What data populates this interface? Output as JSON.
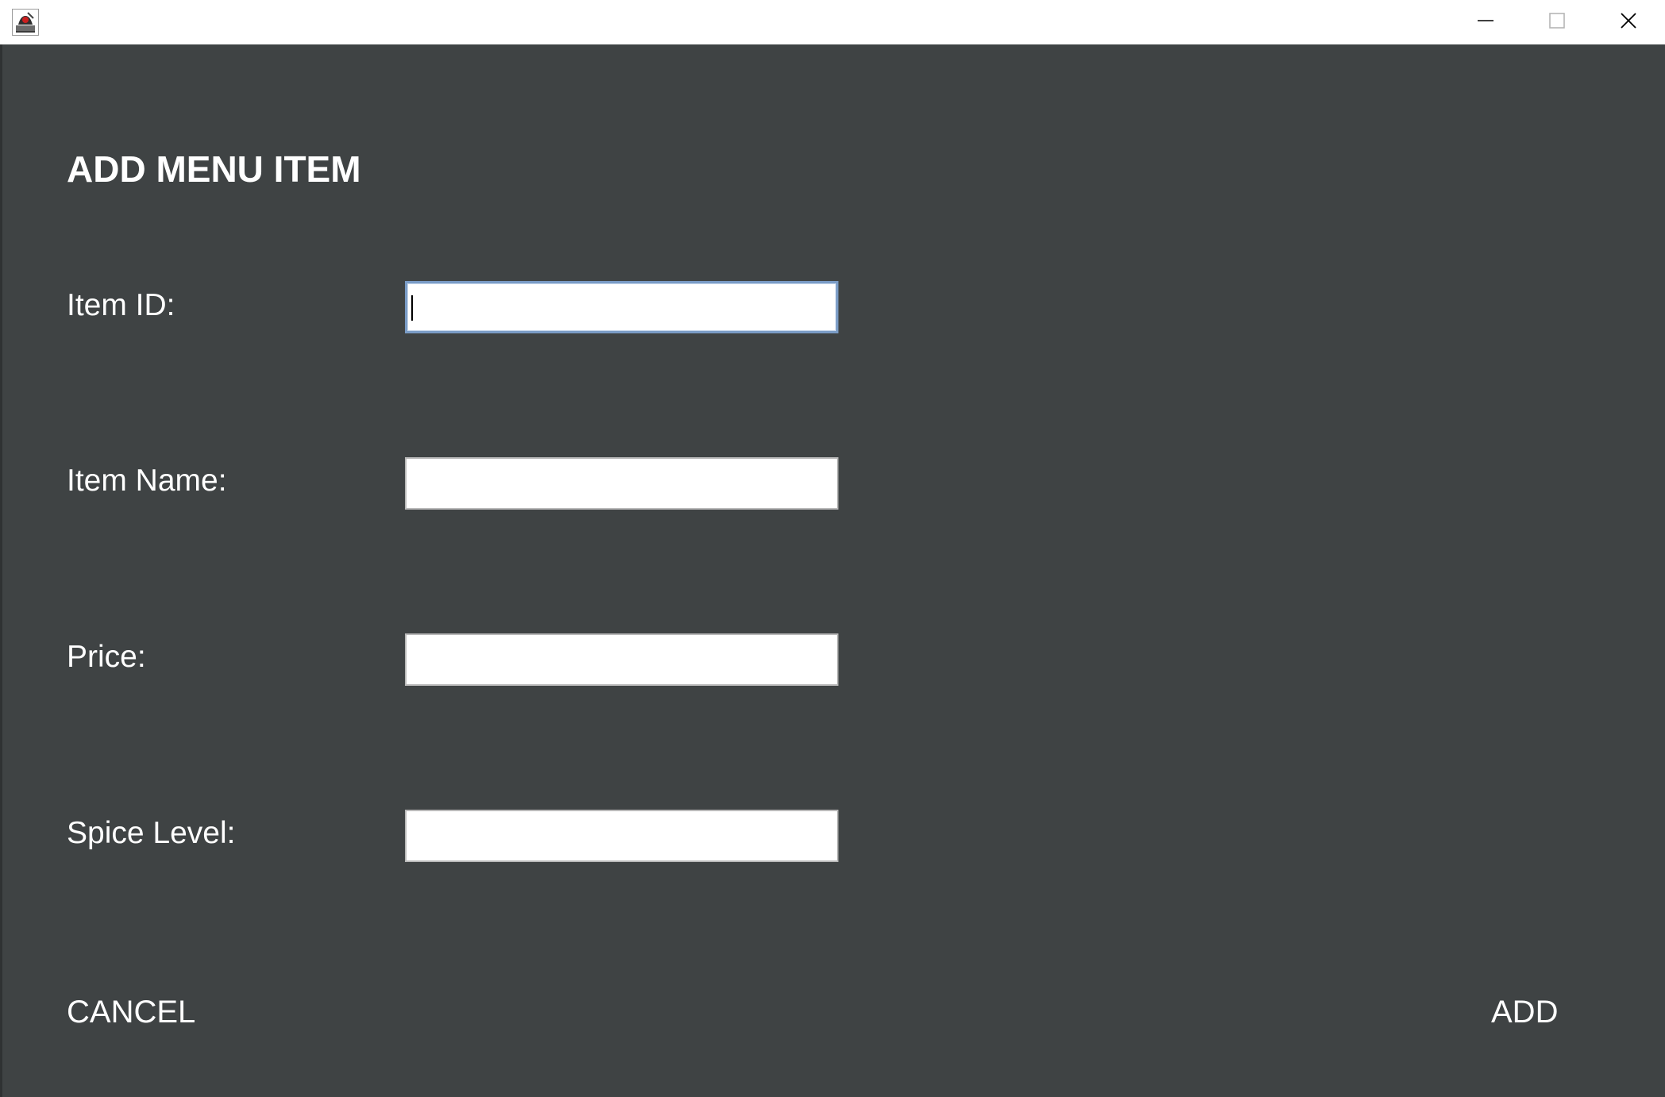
{
  "window": {
    "title_icon": "java-duke-icon",
    "controls": {
      "minimize_icon": "minimize-icon",
      "maximize_icon": "maximize-icon",
      "close_icon": "close-icon"
    }
  },
  "form": {
    "heading": "ADD MENU ITEM",
    "fields": [
      {
        "label": "Item ID:",
        "value": "",
        "placeholder": "",
        "focused": true
      },
      {
        "label": "Item Name:",
        "value": "",
        "placeholder": ""
      },
      {
        "label": "Price:",
        "value": "",
        "placeholder": ""
      },
      {
        "label": "Spice Level:",
        "value": "",
        "placeholder": ""
      }
    ]
  },
  "actions": {
    "cancel_label": "CANCEL",
    "add_label": "ADD"
  },
  "colors": {
    "background": "#3f4344",
    "text": "#ffffff",
    "focus_border": "#7a9cc6"
  }
}
